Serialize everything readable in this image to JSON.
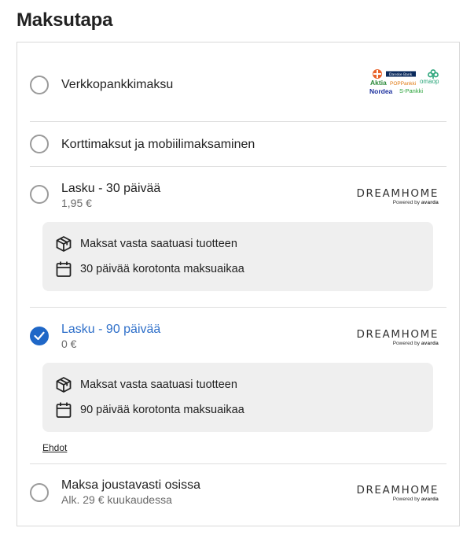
{
  "page": {
    "title": "Maksutapa"
  },
  "options": [
    {
      "title": "Verkkopankkimaksu",
      "selected": false,
      "bank_logos": [
        "Aktia",
        "Danske Bank",
        "POP Pankki",
        "OmaSp",
        "Nordea",
        "S-Pankki"
      ]
    },
    {
      "title": "Korttimaksut ja mobiilimaksaminen",
      "selected": false
    },
    {
      "title": "Lasku - 30 päivää",
      "subtitle": "1,95 €",
      "selected": false,
      "brand": {
        "name": "DREAMHOME",
        "powered_by": "Powered by",
        "provider": "avarda"
      },
      "info": [
        {
          "icon": "package-icon",
          "text": "Maksat vasta saatuasi tuotteen"
        },
        {
          "icon": "calendar-icon",
          "text": "30 päivää korotonta maksuaikaa"
        }
      ]
    },
    {
      "title": "Lasku - 90 päivää",
      "subtitle": "0 €",
      "selected": true,
      "brand": {
        "name": "DREAMHOME",
        "powered_by": "Powered by",
        "provider": "avarda"
      },
      "info": [
        {
          "icon": "package-icon",
          "text": "Maksat vasta saatuasi tuotteen"
        },
        {
          "icon": "calendar-icon",
          "text": "90 päivää korotonta maksuaikaa"
        }
      ],
      "terms_link": "Ehdot"
    },
    {
      "title": "Maksa joustavasti osissa",
      "subtitle": "Alk. 29 € kuukaudessa",
      "selected": false,
      "brand": {
        "name": "DREAMHOME",
        "powered_by": "Powered by",
        "provider": "avarda"
      }
    }
  ],
  "colors": {
    "accent": "#1f67c7",
    "selected_text": "#2e6fc9",
    "info_bg": "#efefef",
    "border": "#d9d9d9"
  }
}
